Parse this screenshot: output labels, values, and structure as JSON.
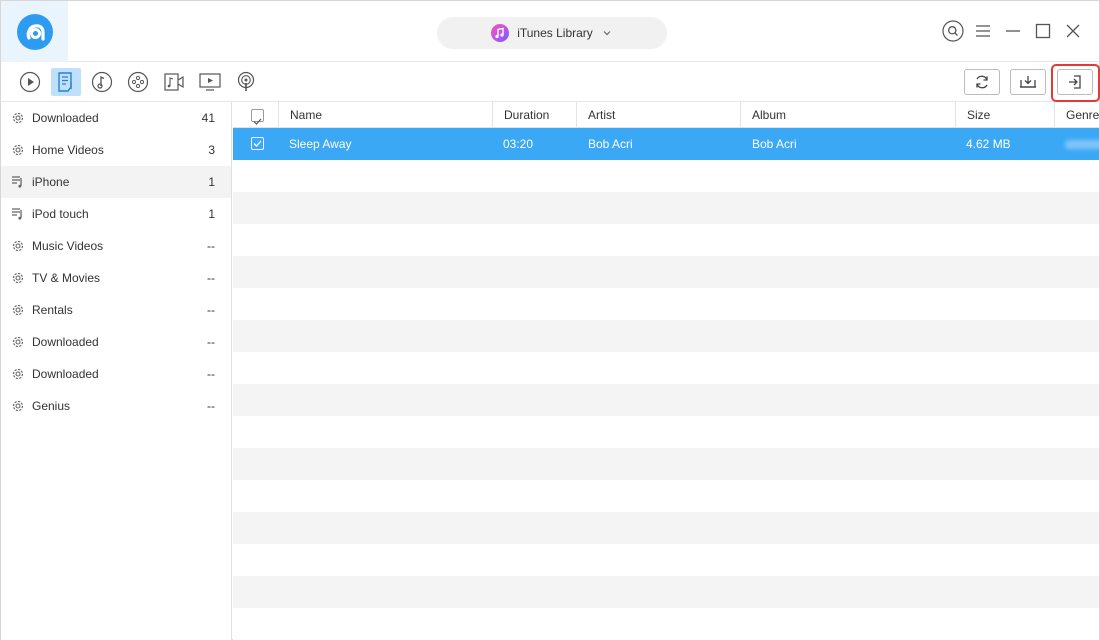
{
  "header": {
    "source_label": "iTunes Library"
  },
  "toolbar": {
    "categories": [
      {
        "icon": "play-circle-icon",
        "active": false
      },
      {
        "icon": "playlist-icon",
        "active": true
      },
      {
        "icon": "music-note-circle-icon",
        "active": false
      },
      {
        "icon": "film-reel-icon",
        "active": false
      },
      {
        "icon": "music-video-icon",
        "active": false
      },
      {
        "icon": "tv-icon",
        "active": false
      },
      {
        "icon": "podcast-icon",
        "active": false
      }
    ],
    "actions": [
      {
        "name": "refresh-button",
        "icon": "refresh-icon"
      },
      {
        "name": "export-to-computer-button",
        "icon": "download-to-computer-icon"
      },
      {
        "name": "add-to-device-button",
        "icon": "import-icon",
        "highlighted": true
      }
    ]
  },
  "sidebar": {
    "items": [
      {
        "label": "Downloaded",
        "count": "41",
        "icon": "gear-icon"
      },
      {
        "label": "Home Videos",
        "count": "3",
        "icon": "gear-icon"
      },
      {
        "label": "iPhone",
        "count": "1",
        "icon": "playlist-icon",
        "active": true
      },
      {
        "label": "iPod touch",
        "count": "1",
        "icon": "playlist-icon"
      },
      {
        "label": "Music Videos",
        "count": "--",
        "icon": "gear-icon"
      },
      {
        "label": "TV & Movies",
        "count": "--",
        "icon": "gear-icon"
      },
      {
        "label": "Rentals",
        "count": "--",
        "icon": "gear-icon"
      },
      {
        "label": "Downloaded",
        "count": "--",
        "icon": "gear-icon"
      },
      {
        "label": "Downloaded",
        "count": "--",
        "icon": "gear-icon"
      },
      {
        "label": "Genius",
        "count": "--",
        "icon": "gear-icon"
      }
    ]
  },
  "table": {
    "columns": [
      "Name",
      "Duration",
      "Artist",
      "Album",
      "Size",
      "Genre"
    ],
    "rows": [
      {
        "name": "Sleep Away",
        "duration": "03:20",
        "artist": "Bob Acri",
        "album": "Bob Acri",
        "size": "4.62 MB",
        "checked": true,
        "selected": true
      }
    ]
  },
  "colors": {
    "accent": "#3ba8f5",
    "highlight_box": "#e53935",
    "active_category": "#bfe0fa"
  }
}
